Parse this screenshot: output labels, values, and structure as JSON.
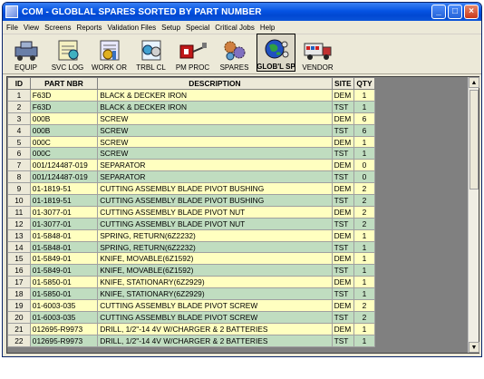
{
  "window": {
    "title": "COM - GLOBLAL SPARES SORTED BY PART NUMBER",
    "minimize_label": "_",
    "maximize_label": "□",
    "close_label": "×"
  },
  "menu": [
    "File",
    "View",
    "Screens",
    "Reports",
    "Validation Files",
    "Setup",
    "Special",
    "Critical Jobs",
    "Help"
  ],
  "toolbar": [
    {
      "label": "EQUIP",
      "icon": "equipment-icon"
    },
    {
      "label": "SVC LOG",
      "icon": "service-log-icon"
    },
    {
      "label": "WORK OR",
      "icon": "work-order-icon"
    },
    {
      "label": "TRBL CL",
      "icon": "trouble-call-icon"
    },
    {
      "label": "PM PROC",
      "icon": "pm-procedure-icon"
    },
    {
      "label": "SPARES",
      "icon": "spares-gears-icon"
    },
    {
      "label": "GLOB'L SP",
      "icon": "global-spares-icon",
      "selected": true
    },
    {
      "label": "VENDOR",
      "icon": "vendor-truck-icon"
    }
  ],
  "table": {
    "headers": [
      "ID",
      "PART NBR",
      "DESCRIPTION",
      "SITE",
      "QTY"
    ],
    "rows": [
      [
        "1",
        "F63D",
        "BLACK & DECKER IRON",
        "DEM",
        "1"
      ],
      [
        "2",
        "F63D",
        "BLACK & DECKER IRON",
        "TST",
        "1"
      ],
      [
        "3",
        "000B",
        "SCREW",
        "DEM",
        "6"
      ],
      [
        "4",
        "000B",
        "SCREW",
        "TST",
        "6"
      ],
      [
        "5",
        "000C",
        "SCREW",
        "DEM",
        "1"
      ],
      [
        "6",
        "000C",
        "SCREW",
        "TST",
        "1"
      ],
      [
        "7",
        "001/124487-019",
        "SEPARATOR",
        "DEM",
        "0"
      ],
      [
        "8",
        "001/124487-019",
        "SEPARATOR",
        "TST",
        "0"
      ],
      [
        "9",
        "01-1819-51",
        "CUTTING ASSEMBLY BLADE PIVOT BUSHING",
        "DEM",
        "2"
      ],
      [
        "10",
        "01-1819-51",
        "CUTTING ASSEMBLY BLADE PIVOT BUSHING",
        "TST",
        "2"
      ],
      [
        "11",
        "01-3077-01",
        "CUTTING ASSEMBLY BLADE PIVOT NUT",
        "DEM",
        "2"
      ],
      [
        "12",
        "01-3077-01",
        "CUTTING ASSEMBLY BLADE PIVOT NUT",
        "TST",
        "2"
      ],
      [
        "13",
        "01-5848-01",
        "SPRING, RETURN(6Z2232)",
        "DEM",
        "1"
      ],
      [
        "14",
        "01-5848-01",
        "SPRING, RETURN(6Z2232)",
        "TST",
        "1"
      ],
      [
        "15",
        "01-5849-01",
        "KNIFE, MOVABLE(6Z1592)",
        "DEM",
        "1"
      ],
      [
        "16",
        "01-5849-01",
        "KNIFE, MOVABLE(6Z1592)",
        "TST",
        "1"
      ],
      [
        "17",
        "01-5850-01",
        "KNIFE, STATIONARY(6Z2929)",
        "DEM",
        "1"
      ],
      [
        "18",
        "01-5850-01",
        "KNIFE, STATIONARY(6Z2929)",
        "TST",
        "1"
      ],
      [
        "19",
        "01-6003-035",
        "CUTTING ASSEMBLY BLADE PIVOT SCREW",
        "DEM",
        "2"
      ],
      [
        "20",
        "01-6003-035",
        "CUTTING ASSEMBLY BLADE PIVOT SCREW",
        "TST",
        "2"
      ],
      [
        "21",
        "012695-R9973",
        "DRILL, 1/2\"-14 4V W/CHARGER & 2 BATTERIES",
        "DEM",
        "1"
      ],
      [
        "22",
        "012695-R9973",
        "DRILL, 1/2\"-14 4V W/CHARGER & 2 BATTERIES",
        "TST",
        "1"
      ]
    ]
  },
  "colors": {
    "title_bar": "#0554e3",
    "row_yellow": "#ffffc0",
    "row_green": "#c0ddc0",
    "grid_background": "#808080"
  }
}
